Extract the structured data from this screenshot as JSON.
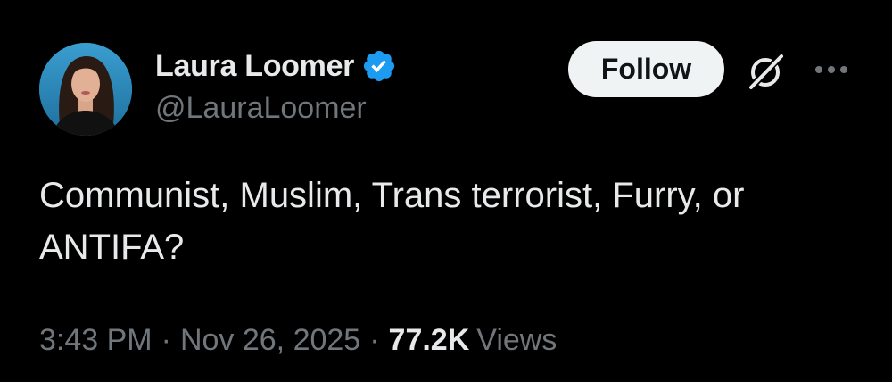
{
  "author": {
    "display_name": "Laura Loomer",
    "handle": "@LauraLoomer",
    "verified": true,
    "avatar_icon": "profile-photo",
    "verified_badge_color": "#1d9bf0"
  },
  "actions": {
    "follow_label": "Follow",
    "grok_icon": "grok-icon",
    "more_icon": "more-horizontal-icon"
  },
  "tweet": {
    "text": "Communist, Muslim, Trans terrorist, Furry, or ANTIFA?"
  },
  "meta": {
    "time": "3:43 PM",
    "separator": "·",
    "date": "Nov 26, 2025",
    "views_count": "77.2K",
    "views_label": "Views"
  },
  "colors": {
    "background": "#000000",
    "primary_text": "#e7e9ea",
    "secondary_text": "#71767b",
    "follow_button_bg": "#eff3f4",
    "follow_button_text": "#0f1419"
  }
}
